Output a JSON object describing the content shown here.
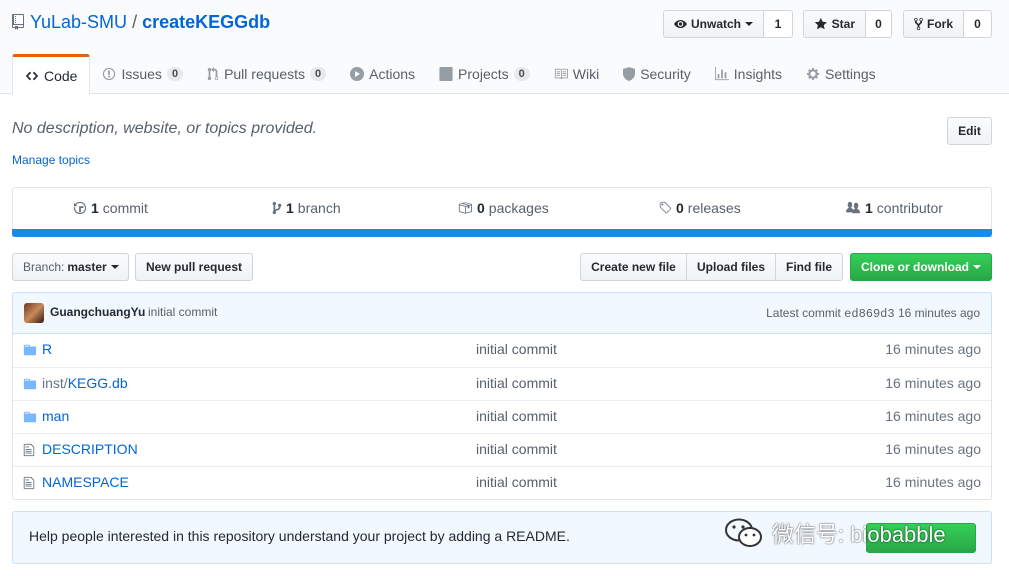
{
  "repo": {
    "owner": "YuLab-SMU",
    "separator": "/",
    "name": "createKEGGdb"
  },
  "actions": {
    "unwatch_label": "Unwatch",
    "unwatch_count": "1",
    "star_label": "Star",
    "star_count": "0",
    "fork_label": "Fork",
    "fork_count": "0"
  },
  "tabs": [
    {
      "label": "Code",
      "icon": "code-icon",
      "counter": ""
    },
    {
      "label": "Issues",
      "icon": "issue-icon",
      "counter": "0"
    },
    {
      "label": "Pull requests",
      "icon": "pull-request-icon",
      "counter": "0"
    },
    {
      "label": "Actions",
      "icon": "play-icon",
      "counter": ""
    },
    {
      "label": "Projects",
      "icon": "project-icon",
      "counter": "0"
    },
    {
      "label": "Wiki",
      "icon": "book-icon",
      "counter": ""
    },
    {
      "label": "Security",
      "icon": "shield-icon",
      "counter": ""
    },
    {
      "label": "Insights",
      "icon": "graph-icon",
      "counter": ""
    },
    {
      "label": "Settings",
      "icon": "gear-icon",
      "counter": ""
    }
  ],
  "about": {
    "description": "No description, website, or topics provided.",
    "edit_label": "Edit",
    "manage_topics": "Manage topics"
  },
  "stats": {
    "commits_count": "1",
    "commits_label": "commit",
    "branches_count": "1",
    "branches_label": "branch",
    "packages_count": "0",
    "packages_label": "packages",
    "releases_count": "0",
    "releases_label": "releases",
    "contributors_count": "1",
    "contributors_label": "contributor"
  },
  "toolbar": {
    "branch_label": "Branch:",
    "branch_value": "master",
    "new_pr": "New pull request",
    "create_file": "Create new file",
    "upload_files": "Upload files",
    "find_file": "Find file",
    "clone": "Clone or download"
  },
  "latest_commit": {
    "author": "GuangchuangYu",
    "message": "initial commit",
    "prefix": "Latest commit",
    "sha": "ed869d3",
    "age": "16 minutes ago"
  },
  "files": [
    {
      "type": "dir",
      "prefix": "",
      "name": "R",
      "message": "initial commit",
      "age": "16 minutes ago"
    },
    {
      "type": "dir",
      "prefix": "inst/",
      "name": "KEGG.db",
      "message": "initial commit",
      "age": "16 minutes ago"
    },
    {
      "type": "dir",
      "prefix": "",
      "name": "man",
      "message": "initial commit",
      "age": "16 minutes ago"
    },
    {
      "type": "file",
      "prefix": "",
      "name": "DESCRIPTION",
      "message": "initial commit",
      "age": "16 minutes ago"
    },
    {
      "type": "file",
      "prefix": "",
      "name": "NAMESPACE",
      "message": "initial commit",
      "age": "16 minutes ago"
    }
  ],
  "readme_prompt": "Help people interested in this repository understand your project by adding a README.",
  "watermark": "微信号: biobabble",
  "colors": {
    "accent": "#0366d6",
    "tab_active": "#e36209",
    "language_bar": "#1e88e5",
    "green": "#28a745"
  }
}
